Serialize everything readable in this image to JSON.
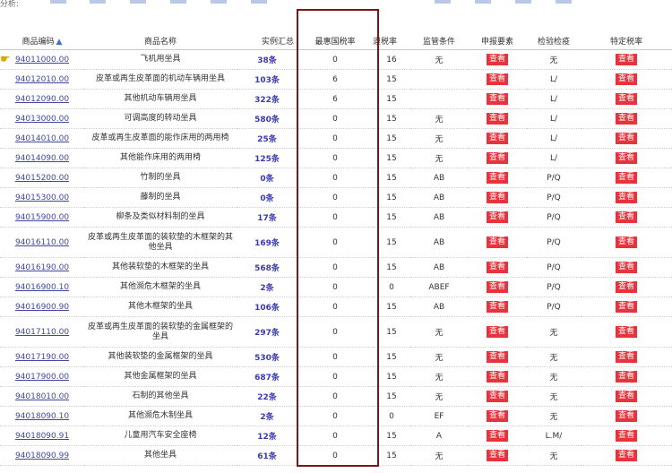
{
  "top_label": "分析:",
  "headers": {
    "code": "商品编码",
    "name": "商品名称",
    "count": "实例汇总",
    "mfn": "最惠国税率",
    "rebate": "退税率",
    "supervision": "监管条件",
    "declare": "申报要素",
    "inspect": "检验检疫",
    "special": "特定税率"
  },
  "view_label": "查看",
  "rows": [
    {
      "code": "94011000.00",
      "name": "飞机用坐具",
      "count": "38条",
      "mfn": "0",
      "rebate": "16",
      "sup": "无",
      "insp": "无"
    },
    {
      "code": "94012010.00",
      "name": "皮革或再生皮革面的机动车辆用坐具",
      "count": "103条",
      "mfn": "6",
      "rebate": "15",
      "sup": "",
      "insp": "L/"
    },
    {
      "code": "94012090.00",
      "name": "其他机动车辆用坐具",
      "count": "322条",
      "mfn": "6",
      "rebate": "15",
      "sup": "",
      "insp": "L/"
    },
    {
      "code": "94013000.00",
      "name": "可调高度的转动坐具",
      "count": "580条",
      "mfn": "0",
      "rebate": "15",
      "sup": "无",
      "insp": "L/"
    },
    {
      "code": "94014010.00",
      "name": "皮革或再生皮革面的能作床用的两用椅",
      "count": "25条",
      "mfn": "0",
      "rebate": "15",
      "sup": "无",
      "insp": "L/"
    },
    {
      "code": "94014090.00",
      "name": "其他能作床用的两用椅",
      "count": "125条",
      "mfn": "0",
      "rebate": "15",
      "sup": "无",
      "insp": "L/"
    },
    {
      "code": "94015200.00",
      "name": "竹制的坐具",
      "count": "0条",
      "mfn": "0",
      "rebate": "15",
      "sup": "AB",
      "insp": "P/Q"
    },
    {
      "code": "94015300.00",
      "name": "藤制的坐具",
      "count": "0条",
      "mfn": "0",
      "rebate": "15",
      "sup": "AB",
      "insp": "P/Q"
    },
    {
      "code": "94015900.00",
      "name": "柳条及类似材料制的坐具",
      "count": "17条",
      "mfn": "0",
      "rebate": "15",
      "sup": "AB",
      "insp": "P/Q"
    },
    {
      "code": "94016110.00",
      "name": "皮革或再生皮革面的装软垫的木框架的其他坐具",
      "count": "169条",
      "mfn": "0",
      "rebate": "15",
      "sup": "AB",
      "insp": "P/Q",
      "tall": true
    },
    {
      "code": "94016190.00",
      "name": "其他装软垫的木框架的坐具",
      "count": "568条",
      "mfn": "0",
      "rebate": "15",
      "sup": "AB",
      "insp": "P/Q"
    },
    {
      "code": "94016900.10",
      "name": "其他濒危木框架的坐具",
      "count": "2条",
      "mfn": "0",
      "rebate": "0",
      "sup": "ABEF",
      "insp": "P/Q"
    },
    {
      "code": "94016900.90",
      "name": "其他木框架的坐具",
      "count": "106条",
      "mfn": "0",
      "rebate": "15",
      "sup": "AB",
      "insp": "P/Q"
    },
    {
      "code": "94017110.00",
      "name": "皮革或再生皮革面的装软垫的金属框架的坐具",
      "count": "297条",
      "mfn": "0",
      "rebate": "15",
      "sup": "无",
      "insp": "无",
      "tall": true
    },
    {
      "code": "94017190.00",
      "name": "其他装软垫的金属框架的坐具",
      "count": "530条",
      "mfn": "0",
      "rebate": "15",
      "sup": "无",
      "insp": "无"
    },
    {
      "code": "94017900.00",
      "name": "其他金属框架的坐具",
      "count": "687条",
      "mfn": "0",
      "rebate": "15",
      "sup": "无",
      "insp": "无"
    },
    {
      "code": "94018010.00",
      "name": "石制的其他坐具",
      "count": "22条",
      "mfn": "0",
      "rebate": "15",
      "sup": "无",
      "insp": "无"
    },
    {
      "code": "94018090.10",
      "name": "其他濒危木制坐具",
      "count": "2条",
      "mfn": "0",
      "rebate": "0",
      "sup": "EF",
      "insp": "无"
    },
    {
      "code": "94018090.91",
      "name": "儿童用汽车安全座椅",
      "count": "12条",
      "mfn": "0",
      "rebate": "15",
      "sup": "A",
      "insp": "L.M/"
    },
    {
      "code": "94018090.99",
      "name": "其他坐具",
      "count": "61条",
      "mfn": "0",
      "rebate": "15",
      "sup": "无",
      "insp": "无"
    }
  ]
}
